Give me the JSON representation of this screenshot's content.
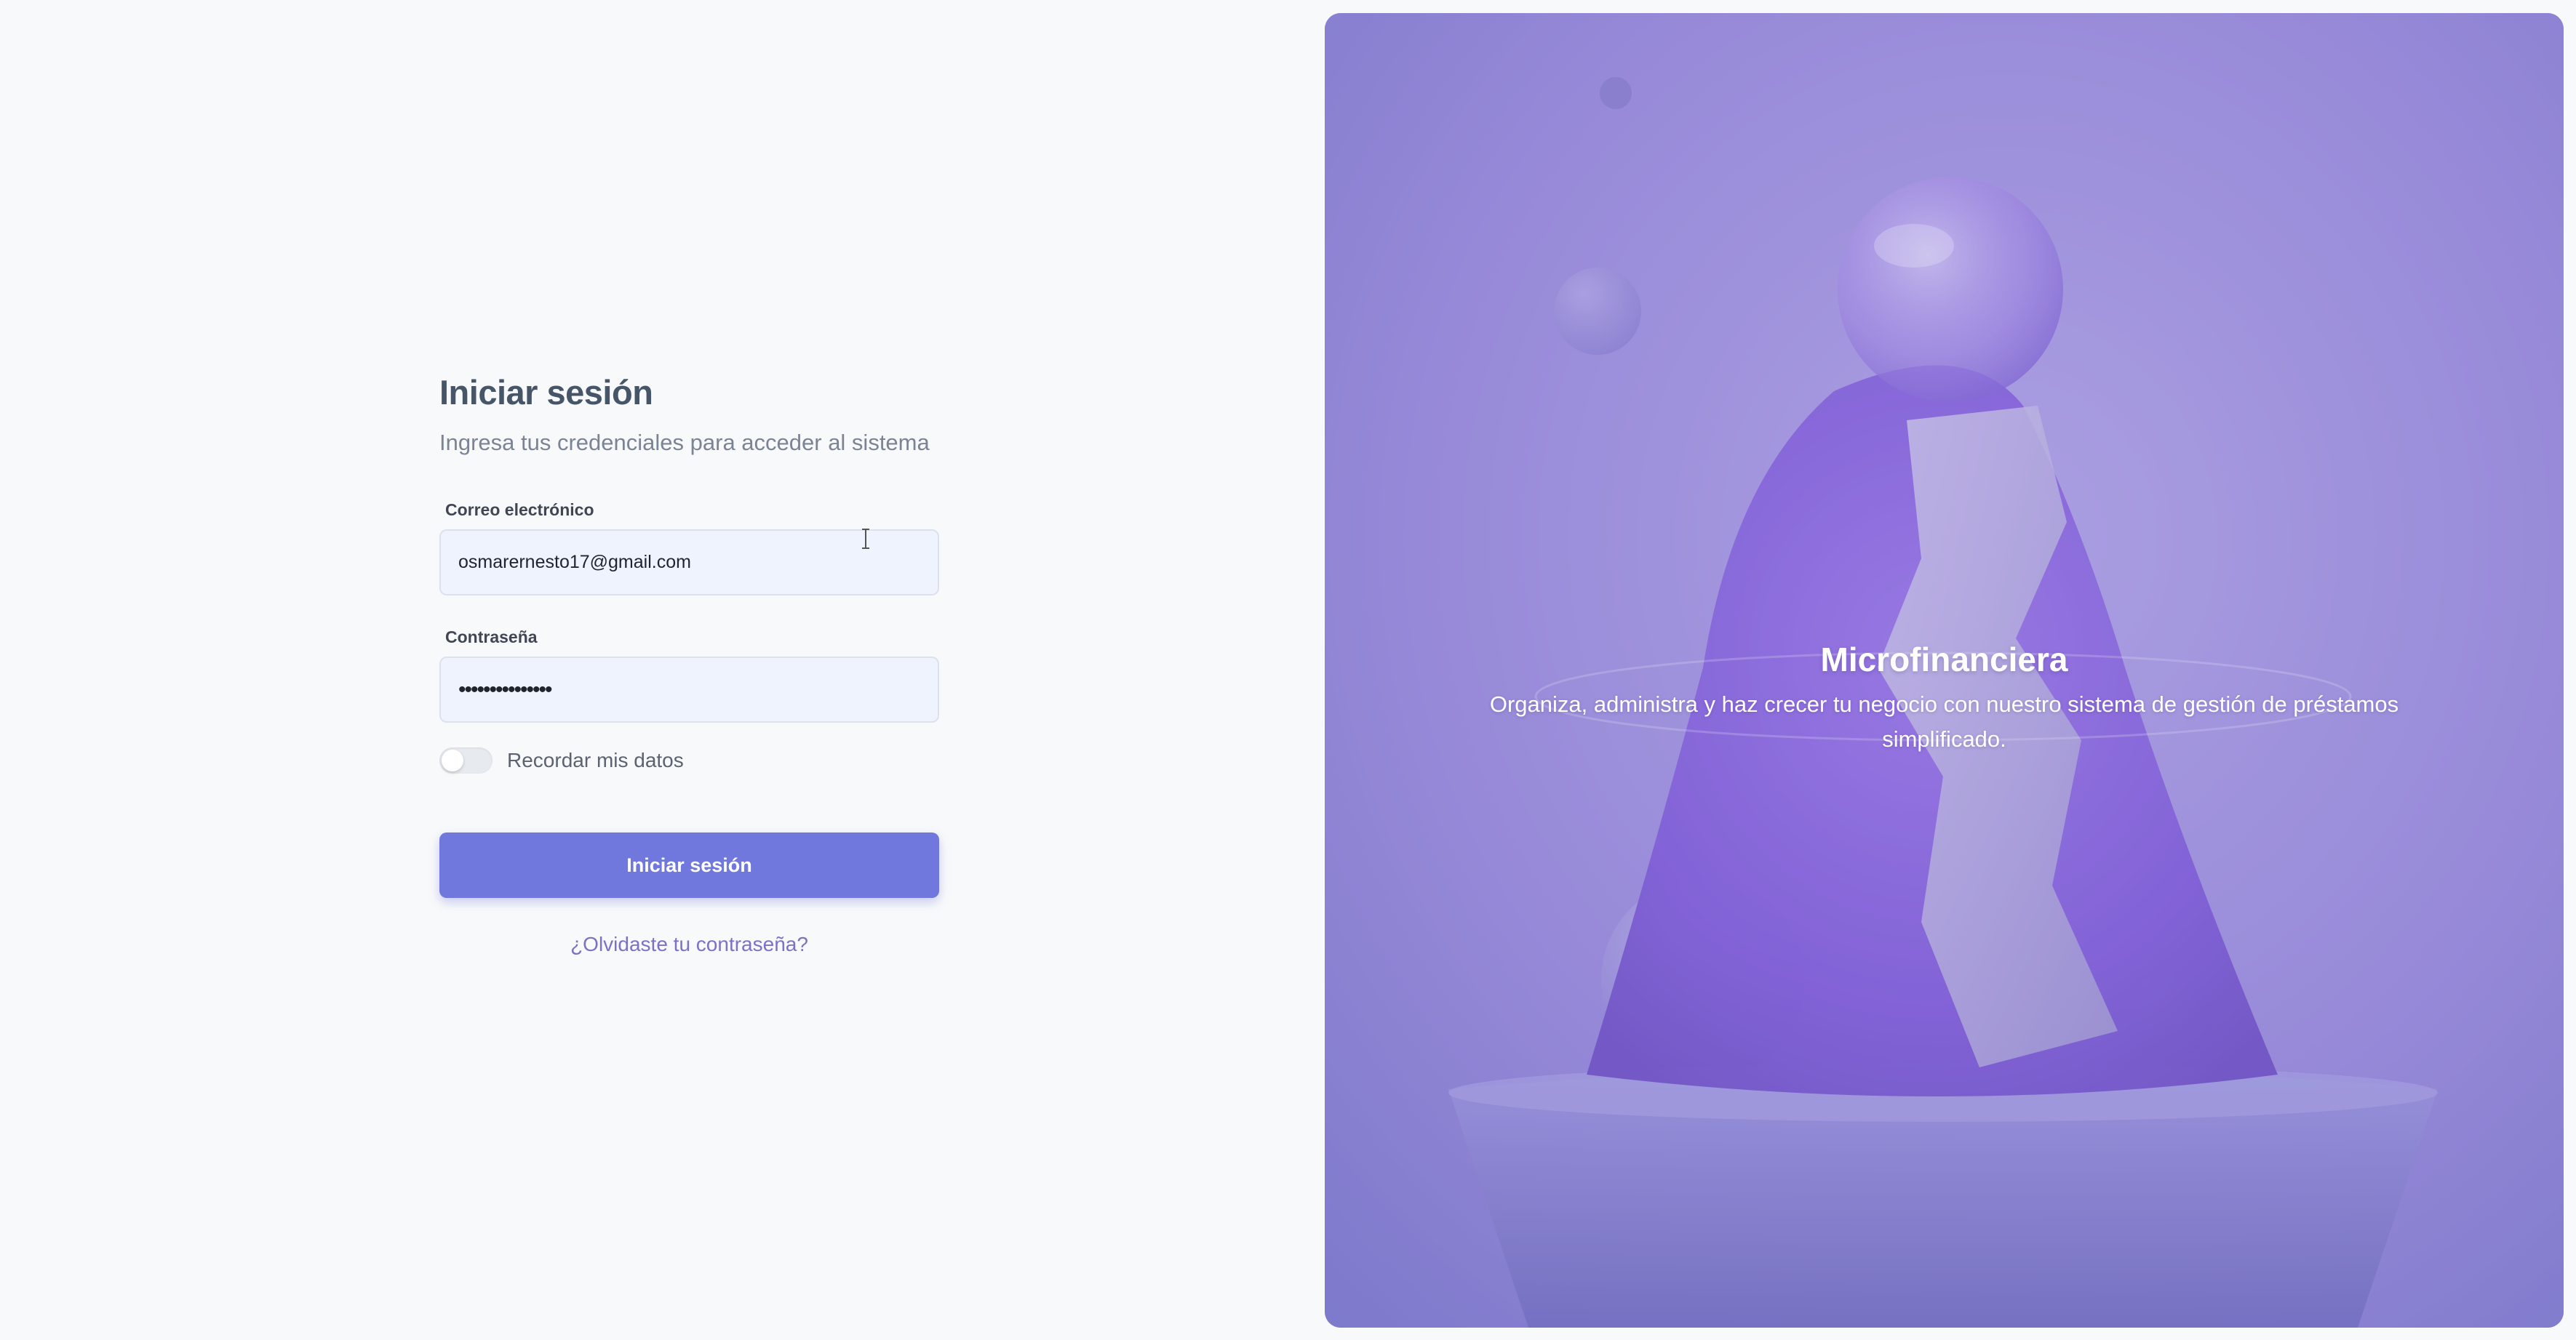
{
  "login": {
    "title": "Iniciar sesión",
    "subtitle": "Ingresa tus credenciales para acceder al sistema",
    "email_label": "Correo electrónico",
    "email_value": "osmarernesto17@gmail.com",
    "password_label": "Contraseña",
    "password_value": "•••••••••••••••",
    "remember_label": "Recordar mis datos",
    "remember_checked": false,
    "submit_label": "Iniciar sesión",
    "forgot_label": "¿Olvidaste tu contraseña?"
  },
  "hero": {
    "title": "Microfinanciera",
    "description": "Organiza, administra y haz crecer tu negocio con nuestro sistema de gestión de préstamos simplificado."
  },
  "colors": {
    "primary_button": "#7078dd",
    "link": "#7b72c6",
    "input_bg": "#eef3fd",
    "hero_purple": "#9f92dc"
  },
  "icons": {
    "cursor": "text-cursor-icon"
  }
}
